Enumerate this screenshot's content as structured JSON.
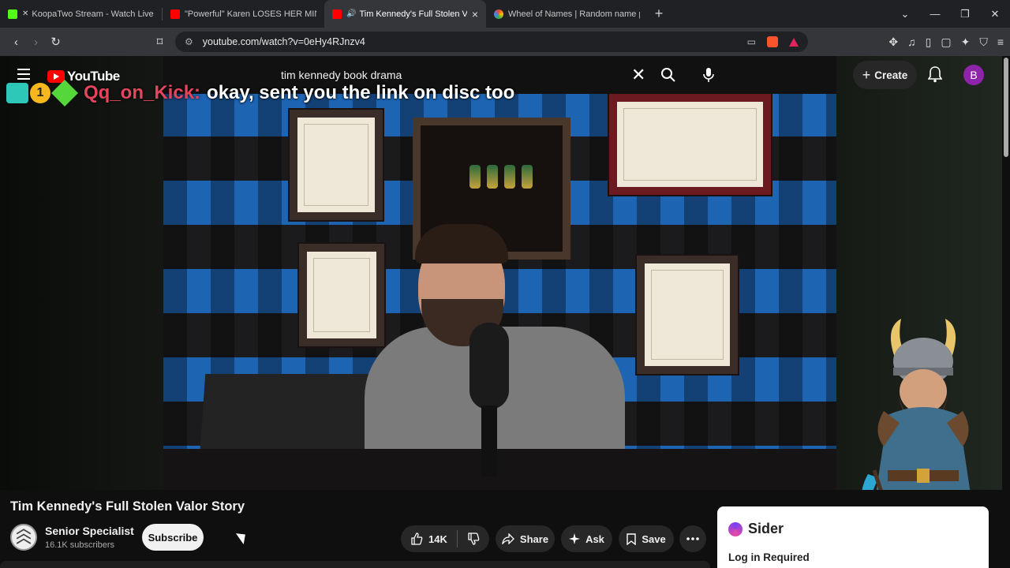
{
  "browser": {
    "tabs": [
      {
        "title": "KoopaTwo Stream - Watch Live on Kick",
        "icon_color": "#53fc18",
        "muted": true
      },
      {
        "title": "\"Powerful\" Karen LOSES HER MIND W",
        "icon_color": "#ff0000",
        "muted": false
      },
      {
        "title": "Tim Kennedy's Full Stolen Valo",
        "icon_color": "#ff0000",
        "audio": true,
        "active": true
      },
      {
        "title": "Wheel of Names | Random name pick",
        "icon_color": "#4285f4",
        "muted": false
      }
    ],
    "url": "youtube.com/watch?v=0eHy4RJnzv4",
    "brave_badge": "99+"
  },
  "youtube": {
    "logo_text": "YouTube",
    "search_value": "tim kennedy book drama",
    "create_label": "Create",
    "avatar_letter": "B",
    "chat_overlay": {
      "user": "Qq_on_Kick:",
      "message": "okay, sent you the link on disc too",
      "badge_number": "1"
    },
    "video": {
      "title": "Tim Kennedy's Full Stolen Valor Story",
      "channel": "Senior Specialist",
      "subscribers": "16.1K subscribers",
      "subscribe_label": "Subscribe",
      "likes": "14K",
      "share_label": "Share",
      "ask_label": "Ask",
      "save_label": "Save"
    },
    "sider": {
      "name": "Sider",
      "login_text": "Log in Required"
    }
  },
  "colors": {
    "accent_red": "#ff0000",
    "avatar_purple": "#8d24aa",
    "chat_user": "#e4455d"
  }
}
